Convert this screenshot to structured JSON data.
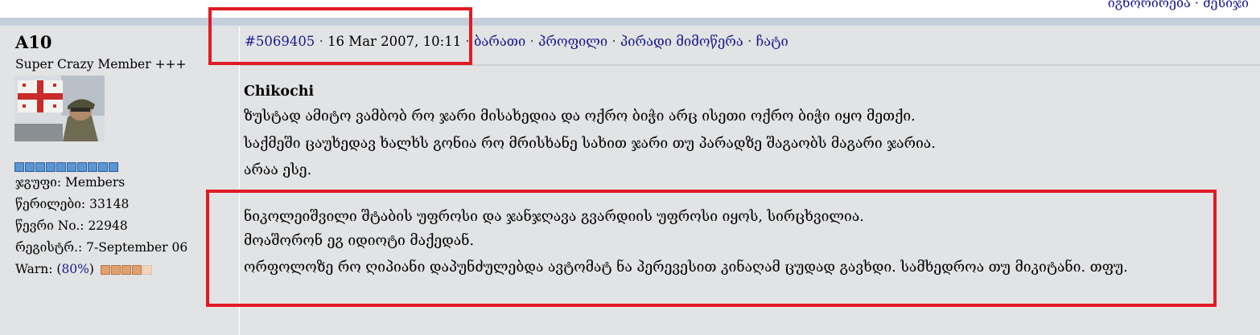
{
  "top_links": [
    "იგნორირება",
    "მესიჯი"
  ],
  "user": {
    "name": "A10",
    "title": "Super Crazy Member +++",
    "rank_pips": 10,
    "group_label": "ჯგუფი:",
    "group_value": "Members",
    "posts_label": "წერილები:",
    "posts_value": "33148",
    "member_no_label": "წევრი No.:",
    "member_no_value": "22948",
    "registered_label": "რეგისტრ.:",
    "registered_value": "7-September 06",
    "warn_label": "Warn:",
    "warn_value": "80%",
    "warn_level_fraction": 0.8
  },
  "post": {
    "id": "#5069405",
    "date": "16 Mar 2007, 10:11",
    "links": [
      "ბარათი",
      "პროფილი",
      "პირადი მიმოწერა",
      "ჩატი"
    ],
    "quote_author": "Chikochi",
    "lines": [
      "ზუსტად ამიტო ვამბობ რო ჯარი მისახედია და ოქრო ბიჭი არც ისეთი ოქრო ბიჭი იყო მეთქი.",
      "საქმეში ცაუხედავ ხალხს გონია რო მრისხანე სახით ჯარი თუ პარადზე შაგაობს მაგარი ჯარია.",
      "არაა ესე."
    ],
    "highlighted_lines": [
      "ნიკოლეიშვილი შტაბის უფროსი და ჯანჯღავა გვარდიის უფროსი იყოს, სირცხვილია.",
      "მოაშორონ ეგ იდიოტი მაქედან.",
      "ორფოლოზე რო ღიპიანი დაპუნძულებდა ავტომატ ნა პერევესით კინაღამ ცუდად გავხდი. სამხედროა თუ მიკიტანი. თფუ."
    ]
  },
  "colors": {
    "background": "#e2e3e5",
    "link": "#1a1a8c",
    "header_bar": "#c5cfdc",
    "annotation_red": "#e01b24",
    "rank_pip": "#5a96d6",
    "warn_pip": "#e0a070"
  }
}
